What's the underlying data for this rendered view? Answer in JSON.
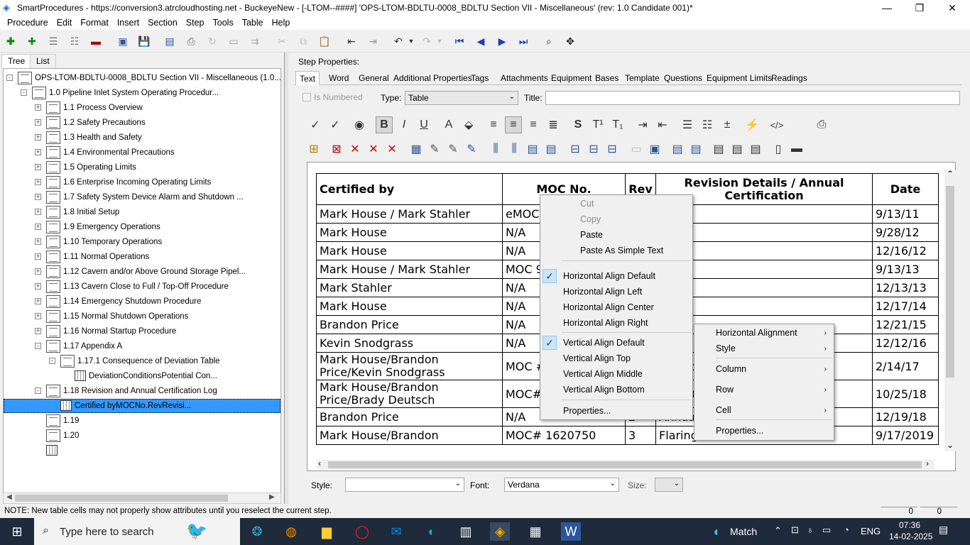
{
  "window": {
    "title": "SmartProcedures - https://conversion3.atrcloudhosting.net - BuckeyeNew - [-LTOM--####] 'OPS-LTOM-BDLTU-0008_BDLTU Section VII - Miscellaneous' (rev: 1.0 Candidate 001)*"
  },
  "menu": [
    "Procedure",
    "Edit",
    "Format",
    "Insert",
    "Section",
    "Step",
    "Tools",
    "Table",
    "Help"
  ],
  "left_tabs": [
    "Tree",
    "List"
  ],
  "tree": [
    {
      "label": "OPS-LTOM-BDLTU-0008_BDLTU Section VII - Miscellaneous (1.0...",
      "level": 0,
      "expander": "-",
      "icon": "doc"
    },
    {
      "label": "1.0 Pipeline Inlet System Operating Procedur...",
      "level": 1,
      "expander": "-",
      "icon": "doc"
    },
    {
      "label": "1.1 Process Overview",
      "level": 2,
      "expander": "+",
      "icon": "doc"
    },
    {
      "label": "1.2 Safety Precautions",
      "level": 2,
      "expander": "+",
      "icon": "doc"
    },
    {
      "label": "1.3 Health and Safety",
      "level": 2,
      "expander": "+",
      "icon": "doc"
    },
    {
      "label": "1.4 Environmental Precautions",
      "level": 2,
      "expander": "+",
      "icon": "doc"
    },
    {
      "label": "1.5 Operating Limits",
      "level": 2,
      "expander": "+",
      "icon": "doc"
    },
    {
      "label": "1.6 Enterprise Incoming Operating Limits",
      "level": 2,
      "expander": "+",
      "icon": "doc"
    },
    {
      "label": "1.7 Safety System Device Alarm and Shutdown ...",
      "level": 2,
      "expander": "+",
      "icon": "doc"
    },
    {
      "label": "1.8 Initial Setup",
      "level": 2,
      "expander": "+",
      "icon": "doc"
    },
    {
      "label": "1.9 Emergency Operations",
      "level": 2,
      "expander": "+",
      "icon": "doc"
    },
    {
      "label": "1.10 Temporary Operations",
      "level": 2,
      "expander": "+",
      "icon": "doc"
    },
    {
      "label": "1.11 Normal Operations",
      "level": 2,
      "expander": "+",
      "icon": "doc"
    },
    {
      "label": "1.12 Cavern and/or Above Ground Storage Pipel...",
      "level": 2,
      "expander": "+",
      "icon": "doc"
    },
    {
      "label": "1.13 Cavern Close to Full / Top-Off Procedure",
      "level": 2,
      "expander": "+",
      "icon": "doc"
    },
    {
      "label": "1.14 Emergency Shutdown Procedure",
      "level": 2,
      "expander": "+",
      "icon": "doc"
    },
    {
      "label": "1.15 Normal Shutdown Operations",
      "level": 2,
      "expander": "+",
      "icon": "doc"
    },
    {
      "label": "1.16 Normal Startup Procedure",
      "level": 2,
      "expander": "+",
      "icon": "doc"
    },
    {
      "label": "1.17 Appendix A",
      "level": 2,
      "expander": "-",
      "icon": "doc"
    },
    {
      "label": "1.17.1 Consequence of Deviation Table",
      "level": 3,
      "expander": "-",
      "icon": "doc"
    },
    {
      "label": "DeviationConditionsPotential Con...",
      "level": 4,
      "expander": "",
      "icon": "table"
    },
    {
      "label": "1.18 Revision and Annual Certification Log",
      "level": 2,
      "expander": "-",
      "icon": "doc"
    },
    {
      "label": "Certified byMOCNo.RevRevisi...",
      "level": 3,
      "expander": "",
      "icon": "table",
      "selected": true
    },
    {
      "label": "1.19",
      "level": 2,
      "expander": "",
      "icon": "doc"
    },
    {
      "label": "1.20",
      "level": 2,
      "expander": "",
      "icon": "doc"
    },
    {
      "label": "",
      "level": 2,
      "expander": "",
      "icon": "table"
    }
  ],
  "step_properties_label": "Step Properties:",
  "tabs": [
    "Text",
    "Word",
    "General",
    "Additional Properties",
    "Tags",
    "Attachments",
    "Equipment",
    "Bases",
    "Template",
    "Questions",
    "Equipment Limits",
    "Readings"
  ],
  "props": {
    "is_numbered_label": "Is Numbered",
    "type_label": "Type:",
    "type_value": "Table",
    "title_label": "Title:",
    "title_value": ""
  },
  "table": {
    "headers": [
      "Certified by",
      "MOC No.",
      "Rev",
      "Revision Details / Annual Certification",
      "Date"
    ],
    "rows": [
      [
        "Mark House /  Mark Stahler",
        "eMOC #",
        "",
        "",
        "9/13/11"
      ],
      [
        "Mark House",
        "N/A",
        "",
        "",
        "9/28/12"
      ],
      [
        "Mark House",
        "N/A",
        "",
        "",
        "12/16/12"
      ],
      [
        "Mark House /  Mark Stahler",
        "MOC 9...",
        "",
        "",
        "9/13/13"
      ],
      [
        "Mark Stahler",
        "N/A",
        "",
        "",
        "12/13/13"
      ],
      [
        "Mark House",
        "N/A",
        "",
        "",
        "12/17/14"
      ],
      [
        "Brandon Price",
        "N/A",
        "",
        "",
        "12/21/15"
      ],
      [
        "Kevin Snodgrass",
        "N/A",
        "",
        "",
        "12/12/16"
      ],
      [
        "Mark House/Brandon Price/Kevin Snodgrass",
        "MOC # 12798",
        "",
        "er ... ckeye",
        "2/14/17"
      ],
      [
        "Mark House/Brandon Price/Brady Deutsch",
        "MOC#",
        "",
        "... 110 ...",
        "10/25/18"
      ],
      [
        "Brandon Price",
        "N/A",
        "2",
        "Annua...",
        "12/19/18"
      ],
      [
        "Mark House/Brandon",
        "MOC# 1620750",
        "3",
        "Flaring Off Cavern Pressure",
        "9/17/2019"
      ]
    ]
  },
  "context_menu": {
    "items": [
      {
        "label": "Cut",
        "disabled": true
      },
      {
        "label": "Copy",
        "disabled": true
      },
      {
        "label": "Paste",
        "disabled": false
      },
      {
        "label": "Paste As Simple Text",
        "disabled": false
      },
      {
        "label": "Horizontal Align Default",
        "checked": true
      },
      {
        "label": "Horizontal Align Left"
      },
      {
        "label": "Horizontal Align Center"
      },
      {
        "label": "Horizontal Align Right"
      },
      {
        "label": "Vertical Align Default",
        "checked": true
      },
      {
        "label": "Vertical Align Top"
      },
      {
        "label": "Vertical Align Middle"
      },
      {
        "label": "Vertical Align Bottom"
      },
      {
        "label": "Properties..."
      }
    ]
  },
  "submenu": {
    "items": [
      "Horizontal Alignment",
      "Style",
      "Column",
      "Row",
      "Cell",
      "Properties..."
    ]
  },
  "bottom": {
    "style_label": "Style:",
    "style_value": "",
    "font_label": "Font:",
    "font_value": "Verdana",
    "size_label": "Size:",
    "size_value": ""
  },
  "status": {
    "note": "NOTE: New table cells may not properly show attributes until you reselect the current step.",
    "num1": "0",
    "num2": "0"
  },
  "taskbar": {
    "search_placeholder": "Type here to search",
    "weather_label": "Match",
    "language": "ENG",
    "time": "07:36",
    "date": "14-02-2025"
  },
  "colors": {
    "selection": "#3399ff",
    "taskbar": "#1f2a3a",
    "menu_check_bg": "#cce4f7"
  }
}
